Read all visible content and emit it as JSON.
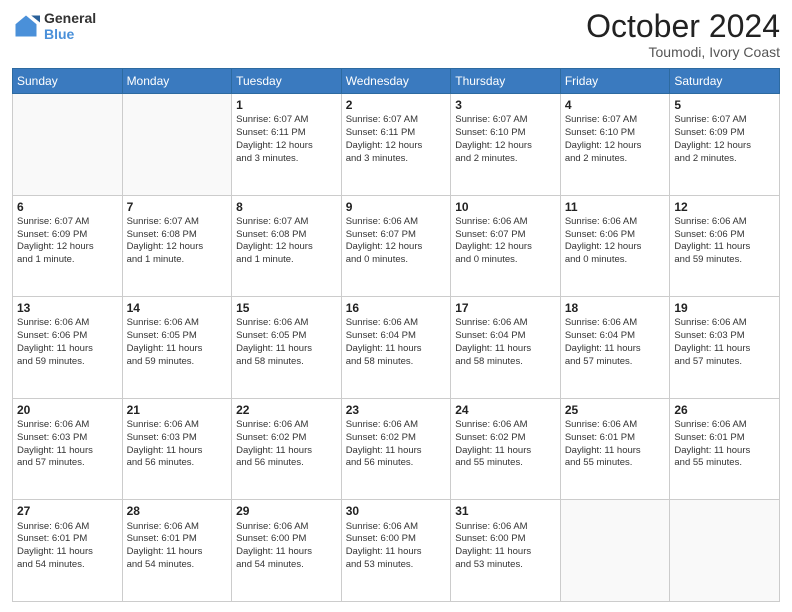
{
  "header": {
    "logo_line1": "General",
    "logo_line2": "Blue",
    "month_year": "October 2024",
    "location": "Toumodi, Ivory Coast"
  },
  "days_of_week": [
    "Sunday",
    "Monday",
    "Tuesday",
    "Wednesday",
    "Thursday",
    "Friday",
    "Saturday"
  ],
  "weeks": [
    [
      {
        "day": "",
        "info": ""
      },
      {
        "day": "",
        "info": ""
      },
      {
        "day": "1",
        "info": "Sunrise: 6:07 AM\nSunset: 6:11 PM\nDaylight: 12 hours\nand 3 minutes."
      },
      {
        "day": "2",
        "info": "Sunrise: 6:07 AM\nSunset: 6:11 PM\nDaylight: 12 hours\nand 3 minutes."
      },
      {
        "day": "3",
        "info": "Sunrise: 6:07 AM\nSunset: 6:10 PM\nDaylight: 12 hours\nand 2 minutes."
      },
      {
        "day": "4",
        "info": "Sunrise: 6:07 AM\nSunset: 6:10 PM\nDaylight: 12 hours\nand 2 minutes."
      },
      {
        "day": "5",
        "info": "Sunrise: 6:07 AM\nSunset: 6:09 PM\nDaylight: 12 hours\nand 2 minutes."
      }
    ],
    [
      {
        "day": "6",
        "info": "Sunrise: 6:07 AM\nSunset: 6:09 PM\nDaylight: 12 hours\nand 1 minute."
      },
      {
        "day": "7",
        "info": "Sunrise: 6:07 AM\nSunset: 6:08 PM\nDaylight: 12 hours\nand 1 minute."
      },
      {
        "day": "8",
        "info": "Sunrise: 6:07 AM\nSunset: 6:08 PM\nDaylight: 12 hours\nand 1 minute."
      },
      {
        "day": "9",
        "info": "Sunrise: 6:06 AM\nSunset: 6:07 PM\nDaylight: 12 hours\nand 0 minutes."
      },
      {
        "day": "10",
        "info": "Sunrise: 6:06 AM\nSunset: 6:07 PM\nDaylight: 12 hours\nand 0 minutes."
      },
      {
        "day": "11",
        "info": "Sunrise: 6:06 AM\nSunset: 6:06 PM\nDaylight: 12 hours\nand 0 minutes."
      },
      {
        "day": "12",
        "info": "Sunrise: 6:06 AM\nSunset: 6:06 PM\nDaylight: 11 hours\nand 59 minutes."
      }
    ],
    [
      {
        "day": "13",
        "info": "Sunrise: 6:06 AM\nSunset: 6:06 PM\nDaylight: 11 hours\nand 59 minutes."
      },
      {
        "day": "14",
        "info": "Sunrise: 6:06 AM\nSunset: 6:05 PM\nDaylight: 11 hours\nand 59 minutes."
      },
      {
        "day": "15",
        "info": "Sunrise: 6:06 AM\nSunset: 6:05 PM\nDaylight: 11 hours\nand 58 minutes."
      },
      {
        "day": "16",
        "info": "Sunrise: 6:06 AM\nSunset: 6:04 PM\nDaylight: 11 hours\nand 58 minutes."
      },
      {
        "day": "17",
        "info": "Sunrise: 6:06 AM\nSunset: 6:04 PM\nDaylight: 11 hours\nand 58 minutes."
      },
      {
        "day": "18",
        "info": "Sunrise: 6:06 AM\nSunset: 6:04 PM\nDaylight: 11 hours\nand 57 minutes."
      },
      {
        "day": "19",
        "info": "Sunrise: 6:06 AM\nSunset: 6:03 PM\nDaylight: 11 hours\nand 57 minutes."
      }
    ],
    [
      {
        "day": "20",
        "info": "Sunrise: 6:06 AM\nSunset: 6:03 PM\nDaylight: 11 hours\nand 57 minutes."
      },
      {
        "day": "21",
        "info": "Sunrise: 6:06 AM\nSunset: 6:03 PM\nDaylight: 11 hours\nand 56 minutes."
      },
      {
        "day": "22",
        "info": "Sunrise: 6:06 AM\nSunset: 6:02 PM\nDaylight: 11 hours\nand 56 minutes."
      },
      {
        "day": "23",
        "info": "Sunrise: 6:06 AM\nSunset: 6:02 PM\nDaylight: 11 hours\nand 56 minutes."
      },
      {
        "day": "24",
        "info": "Sunrise: 6:06 AM\nSunset: 6:02 PM\nDaylight: 11 hours\nand 55 minutes."
      },
      {
        "day": "25",
        "info": "Sunrise: 6:06 AM\nSunset: 6:01 PM\nDaylight: 11 hours\nand 55 minutes."
      },
      {
        "day": "26",
        "info": "Sunrise: 6:06 AM\nSunset: 6:01 PM\nDaylight: 11 hours\nand 55 minutes."
      }
    ],
    [
      {
        "day": "27",
        "info": "Sunrise: 6:06 AM\nSunset: 6:01 PM\nDaylight: 11 hours\nand 54 minutes."
      },
      {
        "day": "28",
        "info": "Sunrise: 6:06 AM\nSunset: 6:01 PM\nDaylight: 11 hours\nand 54 minutes."
      },
      {
        "day": "29",
        "info": "Sunrise: 6:06 AM\nSunset: 6:00 PM\nDaylight: 11 hours\nand 54 minutes."
      },
      {
        "day": "30",
        "info": "Sunrise: 6:06 AM\nSunset: 6:00 PM\nDaylight: 11 hours\nand 53 minutes."
      },
      {
        "day": "31",
        "info": "Sunrise: 6:06 AM\nSunset: 6:00 PM\nDaylight: 11 hours\nand 53 minutes."
      },
      {
        "day": "",
        "info": ""
      },
      {
        "day": "",
        "info": ""
      }
    ]
  ]
}
